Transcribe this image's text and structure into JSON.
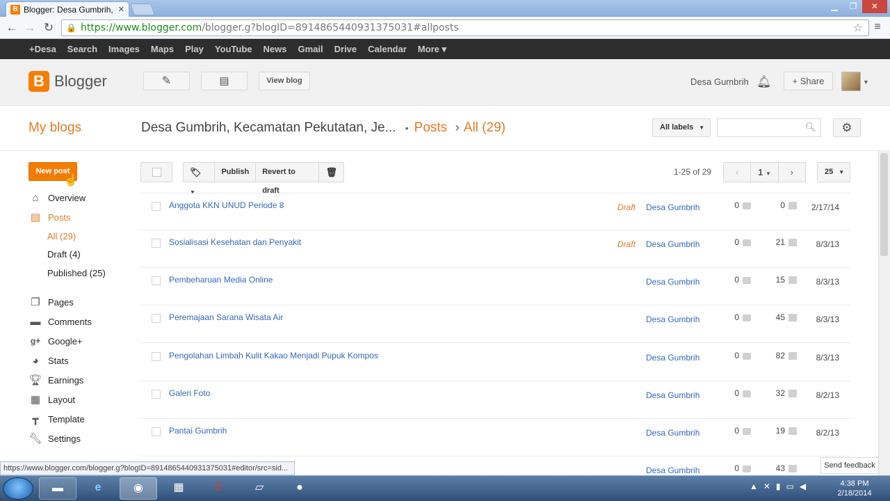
{
  "browser": {
    "tab_title": "Blogger: Desa Gumbrih, Kecamatan Pekutatan",
    "url_scheme": "https://",
    "url_host": "www.blogger.com",
    "url_path": "/blogger.g?blogID=8914865440931375031#allposts",
    "status_url": "https://www.blogger.com/blogger.g?blogID=8914865440931375031#editor/src=sid..."
  },
  "gbar": [
    "+Desa",
    "Search",
    "Images",
    "Maps",
    "Play",
    "YouTube",
    "News",
    "Gmail",
    "Drive",
    "Calendar",
    "More ▾"
  ],
  "header": {
    "logo_text": "Blogger",
    "view_blog": "View blog",
    "user_name": "Desa Gumbrih",
    "share": "Share"
  },
  "subhead": {
    "my_blogs": "My blogs",
    "blog_name": "Desa Gumbrih, Kecamatan Pekutatan, Je...",
    "section": "Posts",
    "filter": "All (29)",
    "labels_button": "All labels"
  },
  "sidebar": {
    "new_post": "New post",
    "items": [
      {
        "label": "Overview",
        "icon": "home-icon"
      },
      {
        "label": "Posts",
        "icon": "posts-icon"
      },
      {
        "label": "Pages",
        "icon": "pages-icon"
      },
      {
        "label": "Comments",
        "icon": "comments-icon"
      },
      {
        "label": "Google+",
        "icon": "google-plus-icon"
      },
      {
        "label": "Stats",
        "icon": "stats-icon"
      },
      {
        "label": "Earnings",
        "icon": "trophy-icon"
      },
      {
        "label": "Layout",
        "icon": "layout-icon"
      },
      {
        "label": "Template",
        "icon": "template-icon"
      },
      {
        "label": "Settings",
        "icon": "wrench-icon"
      }
    ],
    "posts_sub": [
      "All (29)",
      "Draft (4)",
      "Published (25)"
    ]
  },
  "toolbar": {
    "publish": "Publish",
    "revert": "Revert to draft",
    "count": "1-25 of 29",
    "page": "1",
    "per_page": "25"
  },
  "posts": [
    {
      "title": "Anggota KKN UNUD Periode 8",
      "status": "Draft",
      "author": "Desa Gumbrih",
      "comments": "0",
      "views": "0",
      "date": "2/17/14"
    },
    {
      "title": "Sosialisasi Kesehatan dan Penyakit",
      "status": "Draft",
      "author": "Desa Gumbrih",
      "comments": "0",
      "views": "21",
      "date": "8/3/13"
    },
    {
      "title": "Pembeharuan Media Online",
      "status": "",
      "author": "Desa Gumbrih",
      "comments": "0",
      "views": "15",
      "date": "8/3/13"
    },
    {
      "title": "Peremajaan Sarana Wisata Air",
      "status": "",
      "author": "Desa Gumbrih",
      "comments": "0",
      "views": "45",
      "date": "8/3/13"
    },
    {
      "title": "Pengolahan Limbah Kulit Kakao Menjadi Pupuk Kompos",
      "status": "",
      "author": "Desa Gumbrih",
      "comments": "0",
      "views": "82",
      "date": "8/3/13"
    },
    {
      "title": "Galeri Foto",
      "status": "",
      "author": "Desa Gumbrih",
      "comments": "0",
      "views": "32",
      "date": "8/2/13"
    },
    {
      "title": "Pantai Gumbrih",
      "status": "",
      "author": "Desa Gumbrih",
      "comments": "0",
      "views": "19",
      "date": "8/2/13"
    },
    {
      "title": "",
      "status": "",
      "author": "Desa Gumbrih",
      "comments": "0",
      "views": "43",
      "date": "8/"
    }
  ],
  "feedback": "Send feedback",
  "clock": {
    "time": "4:38 PM",
    "date": "2/18/2014"
  },
  "colors": {
    "accent": "#dd7b2a",
    "brand": "#f57d00",
    "link": "#3467b5"
  }
}
